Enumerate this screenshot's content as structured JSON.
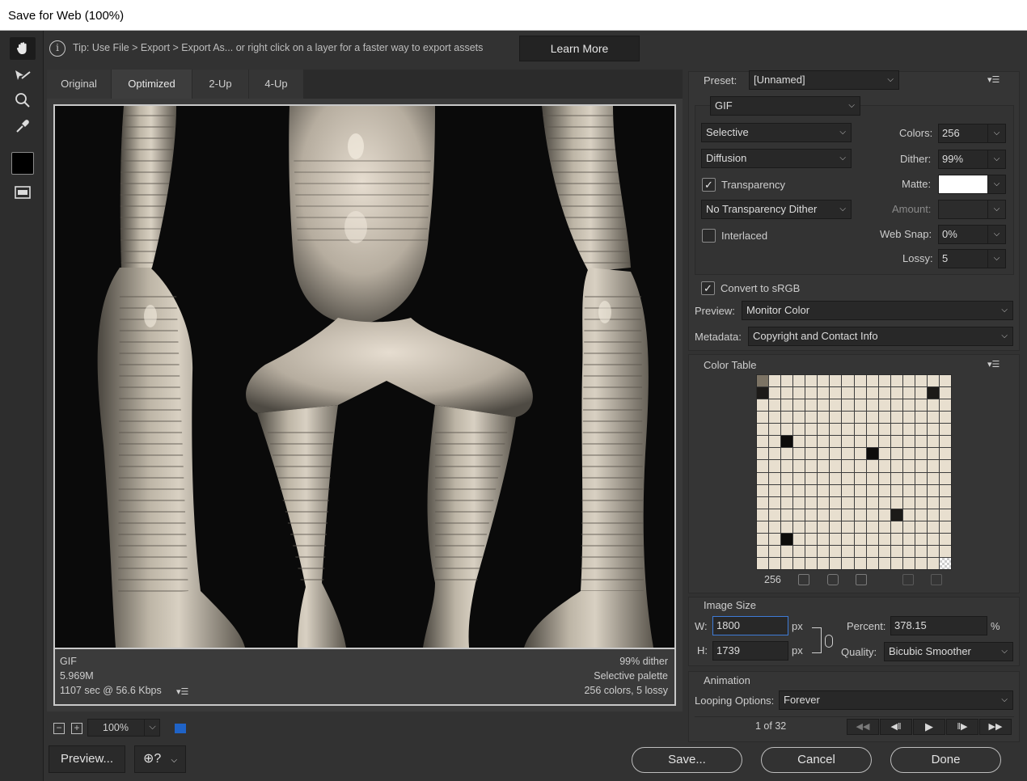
{
  "window": {
    "title": "Save for Web (100%)"
  },
  "tip": {
    "text": "Tip: Use File > Export > Export As...  or right click on a layer for a faster way to export assets",
    "learn_more": "Learn More"
  },
  "tabs": [
    "Original",
    "Optimized",
    "2-Up",
    "4-Up"
  ],
  "active_tab": "Optimized",
  "tools": [
    "hand-icon",
    "slice-select-icon",
    "zoom-icon",
    "eyedropper-icon",
    "color-swatch",
    "toggle-slices-icon"
  ],
  "preview_info": {
    "format": "GIF",
    "size": "5.969M",
    "time": "1107 sec @ 56.6 Kbps",
    "dither": "99% dither",
    "palette": "Selective palette",
    "colors_lossy": "256 colors, 5 lossy"
  },
  "zoom": {
    "value": "100%"
  },
  "bottom_buttons": {
    "preview": "Preview...",
    "save": "Save...",
    "cancel": "Cancel",
    "done": "Done"
  },
  "settings": {
    "preset_label": "Preset:",
    "preset": "[Unnamed]",
    "format": "GIF",
    "reduction": "Selective",
    "dither_algo": "Diffusion",
    "transparency_label": "Transparency",
    "transparency_checked": true,
    "transparency_dither": "No Transparency Dither",
    "interlaced_label": "Interlaced",
    "interlaced_checked": false,
    "colors_label": "Colors:",
    "colors": "256",
    "dither_label": "Dither:",
    "dither": "99%",
    "matte_label": "Matte:",
    "amount_label": "Amount:",
    "amount": "",
    "websnap_label": "Web Snap:",
    "websnap": "0%",
    "lossy_label": "Lossy:",
    "lossy": "5",
    "convert_srgb_label": "Convert to sRGB",
    "convert_srgb_checked": true,
    "preview_label": "Preview:",
    "preview": "Monitor Color",
    "metadata_label": "Metadata:",
    "metadata": "Copyright and Contact Info"
  },
  "color_table": {
    "title": "Color Table",
    "count": "256"
  },
  "image_size": {
    "title": "Image Size",
    "w_label": "W:",
    "w": "1800",
    "h_label": "H:",
    "h": "1739",
    "unit": "px",
    "percent_label": "Percent:",
    "percent": "378.15",
    "percent_unit": "%",
    "quality_label": "Quality:",
    "quality": "Bicubic Smoother"
  },
  "animation": {
    "title": "Animation",
    "looping_label": "Looping Options:",
    "looping": "Forever",
    "frame": "1 of 32"
  },
  "colors": {
    "accent_blue": "#1f63c7",
    "panel_bg": "#323232"
  }
}
